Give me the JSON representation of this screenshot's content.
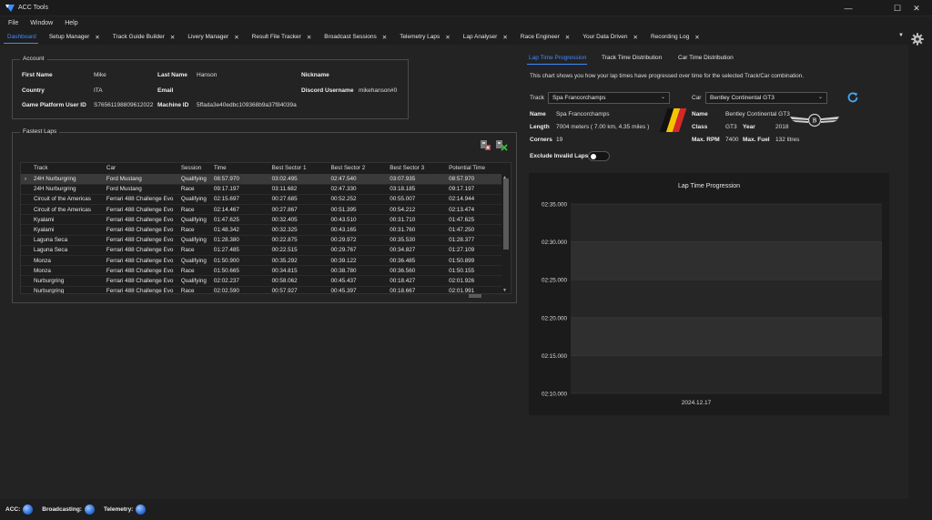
{
  "app": {
    "title": "ACC Tools"
  },
  "window_controls": {
    "minimize": "—",
    "maximize": "☐",
    "close": "✕"
  },
  "menu": [
    "File",
    "Window",
    "Help"
  ],
  "tabs": [
    {
      "label": "Dashboard",
      "active": true,
      "closable": false
    },
    {
      "label": "Setup Manager",
      "closable": true
    },
    {
      "label": "Track Guide Builder",
      "closable": true
    },
    {
      "label": "Livery Manager",
      "closable": true
    },
    {
      "label": "Result File Tracker",
      "closable": true
    },
    {
      "label": "Broadcast Sessions",
      "closable": true
    },
    {
      "label": "Telemetry Laps",
      "closable": true
    },
    {
      "label": "Lap Analyser",
      "closable": true
    },
    {
      "label": "Race Engineer",
      "closable": true
    },
    {
      "label": "Your Data Driven",
      "closable": true
    },
    {
      "label": "Recording Log",
      "closable": true
    }
  ],
  "tab_close_glyph": "✕",
  "account": {
    "legend": "Account",
    "first_name_label": "First Name",
    "first_name": "Mike",
    "last_name_label": "Last Name",
    "last_name": "Hanson",
    "nickname_label": "Nickname",
    "nickname": "",
    "country_label": "Country",
    "country": "ITA",
    "email_label": "Email",
    "email": "",
    "discord_label": "Discord Username",
    "discord": "mikehanson#0",
    "platform_label": "Game Platform User ID",
    "platform_id": "S76561198809612022",
    "machine_label": "Machine ID",
    "machine_id": "5ffada3e40edbc109368b9a37f84039a"
  },
  "fastest_laps": {
    "legend": "Fastest Laps",
    "columns": [
      "Track",
      "Car",
      "Session",
      "Time",
      "Best Sector 1",
      "Best Sector 2",
      "Best Sector 3",
      "Potential Time"
    ],
    "rows": [
      [
        "24H Nurburgring",
        "Ford Mustang",
        "Qualifying",
        "08:57.970",
        "03:02.495",
        "02:47.540",
        "03:07.935",
        "08:57.970"
      ],
      [
        "24H Nurburgring",
        "Ford Mustang",
        "Race",
        "09:17.197",
        "03:11.682",
        "02:47.330",
        "03:18.185",
        "09:17.197"
      ],
      [
        "Circuit of the Americas",
        "Ferrari 488 Challenge Evo",
        "Qualifying",
        "02:15.697",
        "00:27.685",
        "00:52.252",
        "00:55.007",
        "02:14.944"
      ],
      [
        "Circuit of the Americas",
        "Ferrari 488 Challenge Evo",
        "Race",
        "02:14.467",
        "00:27.867",
        "00:51.395",
        "00:54.212",
        "02:13.474"
      ],
      [
        "Kyalami",
        "Ferrari 488 Challenge Evo",
        "Qualifying",
        "01:47.625",
        "00:32.405",
        "00:43.510",
        "00:31.710",
        "01:47.625"
      ],
      [
        "Kyalami",
        "Ferrari 488 Challenge Evo",
        "Race",
        "01:48.342",
        "00:32.325",
        "00:43.165",
        "00:31.760",
        "01:47.250"
      ],
      [
        "Laguna Seca",
        "Ferrari 488 Challenge Evo",
        "Qualifying",
        "01:28.380",
        "00:22.875",
        "00:29.972",
        "00:35.530",
        "01:28.377"
      ],
      [
        "Laguna Seca",
        "Ferrari 488 Challenge Evo",
        "Race",
        "01:27.485",
        "00:22.515",
        "00:29.767",
        "00:34.827",
        "01:27.109"
      ],
      [
        "Monza",
        "Ferrari 488 Challenge Evo",
        "Qualifying",
        "01:50.900",
        "00:35.292",
        "00:39.122",
        "00:36.485",
        "01:50.899"
      ],
      [
        "Monza",
        "Ferrari 488 Challenge Evo",
        "Race",
        "01:50.665",
        "00:34.815",
        "00:38.780",
        "00:36.560",
        "01:50.155"
      ],
      [
        "Nurburgring",
        "Ferrari 488 Challenge Evo",
        "Qualifying",
        "02:02.237",
        "00:58.062",
        "00:45.437",
        "00:18.427",
        "02:01.926"
      ],
      [
        "Nurburgring",
        "Ferrari 488 Challenge Evo",
        "Race",
        "02:02.590",
        "00:57.927",
        "00:45.397",
        "00:18.667",
        "02:01.991"
      ]
    ],
    "selected_index": 0
  },
  "right": {
    "tabs": [
      "Lap Time Progression",
      "Track Time Distribution",
      "Car Time Distribution"
    ],
    "description": "This chart shows you how your lap times have progressed over time for the selected Track/Car combination.",
    "track_label": "Track",
    "track_value": "Spa Francorchamps",
    "car_label": "Car",
    "car_value": "Bentley Continental GT3",
    "track_info": {
      "name_label": "Name",
      "name": "Spa Francorchamps",
      "length_label": "Length",
      "length": "7004 meters (   7.00 km,   4.35 miles  )",
      "corners_label": "Corners",
      "corners": "19"
    },
    "car_info": {
      "name_label": "Name",
      "name": "Bentley Continental GT3",
      "class_label": "Class",
      "class": "GT3",
      "year_label": "Year",
      "year": "2018",
      "rpm_label": "Max. RPM",
      "rpm": "7400",
      "fuel_label": "Max. Fuel",
      "fuel": "132 litres"
    },
    "exclude_label": "Exclude Invalid Laps",
    "exclude_on": false
  },
  "chart_data": {
    "type": "line",
    "title": "Lap Time Progression",
    "y_ticks": [
      "02:35.000",
      "02:30.000",
      "02:25.000",
      "02:20.000",
      "02:15.000",
      "02:10.000"
    ],
    "x_ticks": [
      "2024.12.17"
    ],
    "ylim": [
      "02:10.000",
      "02:35.000"
    ],
    "series": [],
    "grid": true,
    "colors": {
      "background": "#1b1b1b",
      "band_light": "#2f2f2f",
      "band_dark": "#262626"
    }
  },
  "status_bar": [
    {
      "label": "ACC:"
    },
    {
      "label": "Broadcasting:"
    },
    {
      "label": "Telemetry:"
    }
  ],
  "colors": {
    "accent": "#3d8bff",
    "background": "#1e1e1e",
    "panel": "#232323",
    "refresh": "#3fa9f5"
  }
}
